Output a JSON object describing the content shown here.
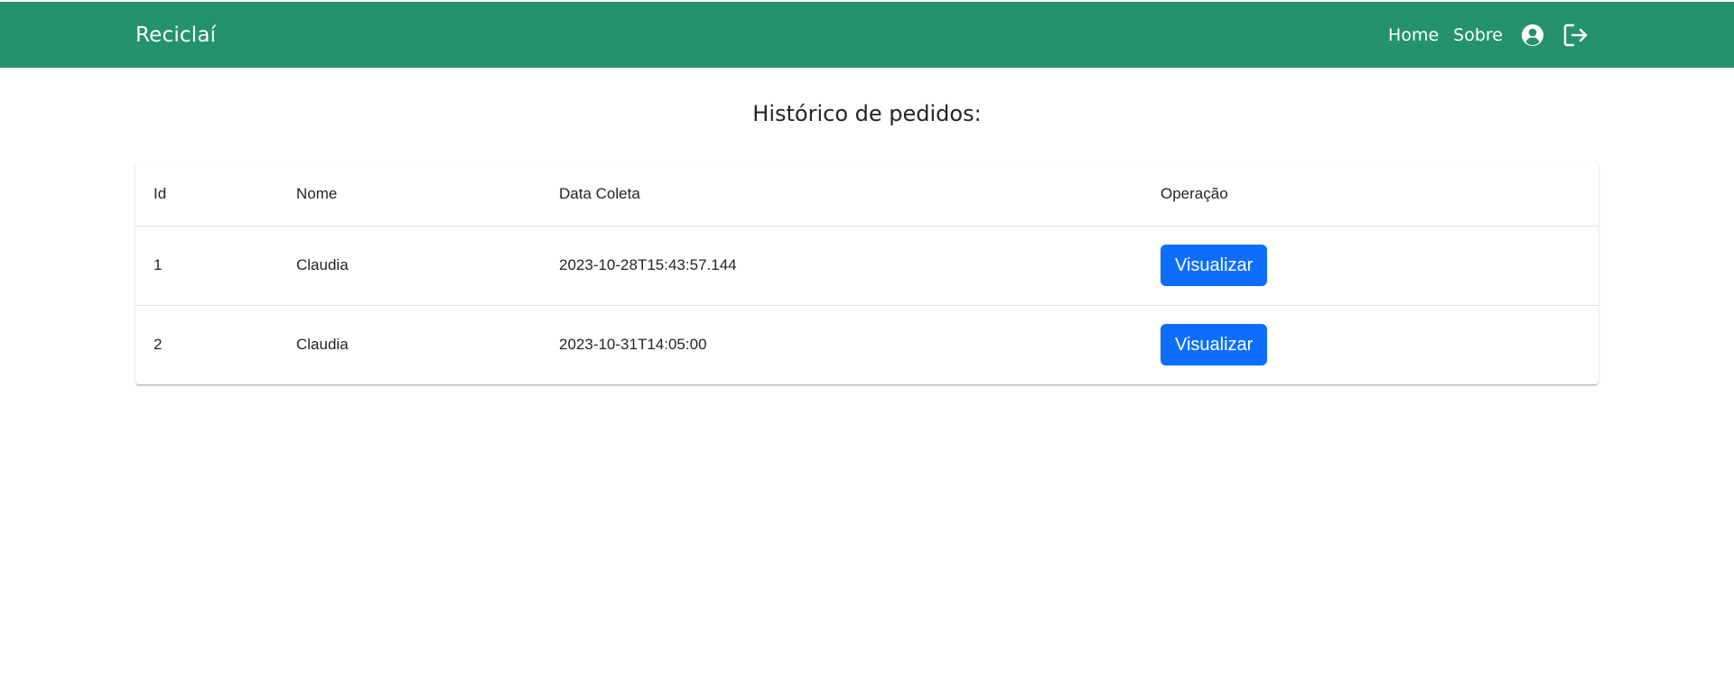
{
  "navbar": {
    "brand": "Reciclaí",
    "links": [
      "Home",
      "Sobre"
    ],
    "icons": [
      "user-circle-icon",
      "logout-icon"
    ],
    "color": "#24936d"
  },
  "page": {
    "title": "Histórico de pedidos:"
  },
  "table": {
    "headers": [
      "Id",
      "Nome",
      "Data Coleta",
      "Operação"
    ],
    "rows": [
      {
        "id": "1",
        "nome": "Claudia",
        "data_coleta": "2023-10-28T15:43:57.144",
        "action": "Visualizar"
      },
      {
        "id": "2",
        "nome": "Claudia",
        "data_coleta": "2023-10-31T14:05:00",
        "action": "Visualizar"
      }
    ],
    "button_color": "#0d6efd"
  }
}
